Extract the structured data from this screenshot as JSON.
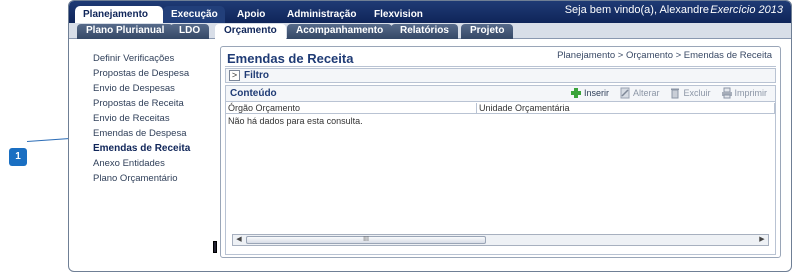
{
  "annotation": {
    "marker": "1"
  },
  "top_nav": {
    "tabs": [
      {
        "label": "Planejamento"
      },
      {
        "label": "Execução"
      },
      {
        "label": "Apoio"
      },
      {
        "label": "Administração"
      },
      {
        "label": "Flexvision"
      }
    ],
    "welcome": "Seja bem vindo(a), Alexandre",
    "exercise": "Exercício 2013"
  },
  "sub_nav": {
    "tabs": [
      {
        "label": "Plano Plurianual"
      },
      {
        "label": "LDO"
      },
      {
        "label": "Orçamento"
      },
      {
        "label": "Acompanhamento"
      },
      {
        "label": "Relatórios"
      },
      {
        "label": "Projeto"
      }
    ]
  },
  "sidebar": {
    "items": [
      {
        "label": "Definir Verificações"
      },
      {
        "label": "Propostas de Despesa"
      },
      {
        "label": "Envio de Despesas"
      },
      {
        "label": "Propostas de Receita"
      },
      {
        "label": "Envio de Receitas"
      },
      {
        "label": "Emendas de Despesa"
      },
      {
        "label": "Emendas de Receita"
      },
      {
        "label": "Anexo Entidades"
      },
      {
        "label": "Plano Orçamentário"
      }
    ]
  },
  "main": {
    "title": "Emendas de Receita",
    "breadcrumb": "Planejamento > Orçamento > Emendas de Receita",
    "filter_label": "Filtro",
    "filter_toggle": ">",
    "content_label": "Conteúdo",
    "toolbar": {
      "insert": "Inserir",
      "edit": "Alterar",
      "delete": "Excluir",
      "print": "Imprimir"
    },
    "columns": [
      "Órgão Orçamento",
      "Unidade Orçamentária"
    ],
    "empty_message": "Não há dados para esta consulta.",
    "scroll_thumb_label": "III"
  },
  "colors": {
    "header": "#1f3b75",
    "accent": "#1a6fc2"
  }
}
